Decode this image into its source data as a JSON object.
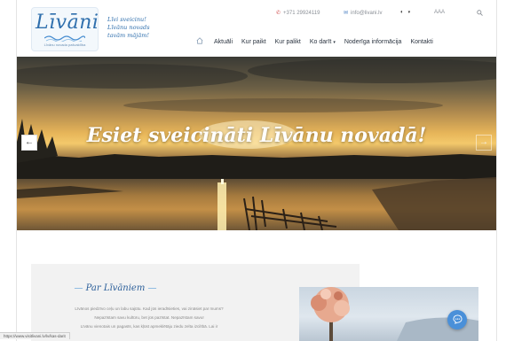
{
  "logo": {
    "name": "Līvāni",
    "sub": "Līvānu novada pašvaldība"
  },
  "slogan": [
    "Līvi sveicinu!",
    "Līvānu novads",
    "tavām mājām!"
  ],
  "header": {
    "phone": "+371 29924119",
    "email": "info@livani.lv",
    "contrast_chevron": "▾",
    "font_size_control": "AAA",
    "search_icon": "search-icon"
  },
  "nav": {
    "home_icon": "home-icon",
    "items": [
      "Aktuāli",
      "Kur paikt",
      "Kur palikt",
      "Ko darīt",
      "Noderīga informācija",
      "Kontakti"
    ],
    "dropdown_chevron": "▾"
  },
  "hero": {
    "title": "Esiet sveicināti Līvānu novadā!",
    "prev": "←",
    "next": "→"
  },
  "about": {
    "title": "Par Līvāniem",
    "lines": [
      "Līvānos piedzīvo ceļu un labu sajūtu. Kad jūs ieradīsieties, vai zināsiet par mums?",
      "Nepazīstam savu kultūru, bet jūs pazīstat. Nepazīstam savu!",
      "Līvānu vienotais un pagasts, kas kļūst apmeklētāju ziedu zelta izcilībā. Lai ir"
    ]
  },
  "chat": {
    "icon": "chat-bubble-icon"
  },
  "status_bar": {
    "url": "https://www.visitlivani.lv/lv/kas-darit"
  }
}
